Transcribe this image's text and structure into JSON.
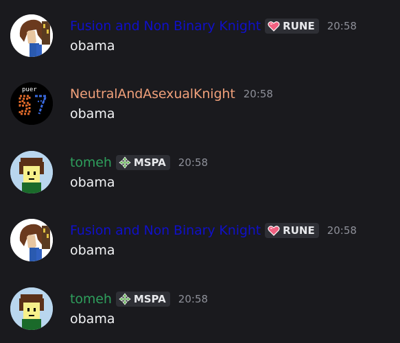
{
  "messages": [
    {
      "username": "Fusion and Non Binary Knight",
      "username_color": "#1010c8",
      "tag_icon": "heart-icon",
      "tag": "RUNE",
      "time": "20:58",
      "content": "obama"
    },
    {
      "username": "NeutralAndAsexualKnight",
      "username_color": "#f0a07a",
      "time": "20:58",
      "content": "obama"
    },
    {
      "username": "tomeh",
      "username_color": "#2e9e5c",
      "tag_icon": "diamond-arrows-icon",
      "tag": "MSPA",
      "time": "20:58",
      "content": "obama"
    },
    {
      "username": "Fusion and Non Binary Knight",
      "username_color": "#1010c8",
      "tag_icon": "heart-icon",
      "tag": "RUNE",
      "time": "20:58",
      "content": "obama"
    },
    {
      "username": "tomeh",
      "username_color": "#2e9e5c",
      "tag_icon": "diamond-arrows-icon",
      "tag": "MSPA",
      "time": "20:58",
      "content": "obama"
    }
  ],
  "avatar_2_text": "puer"
}
